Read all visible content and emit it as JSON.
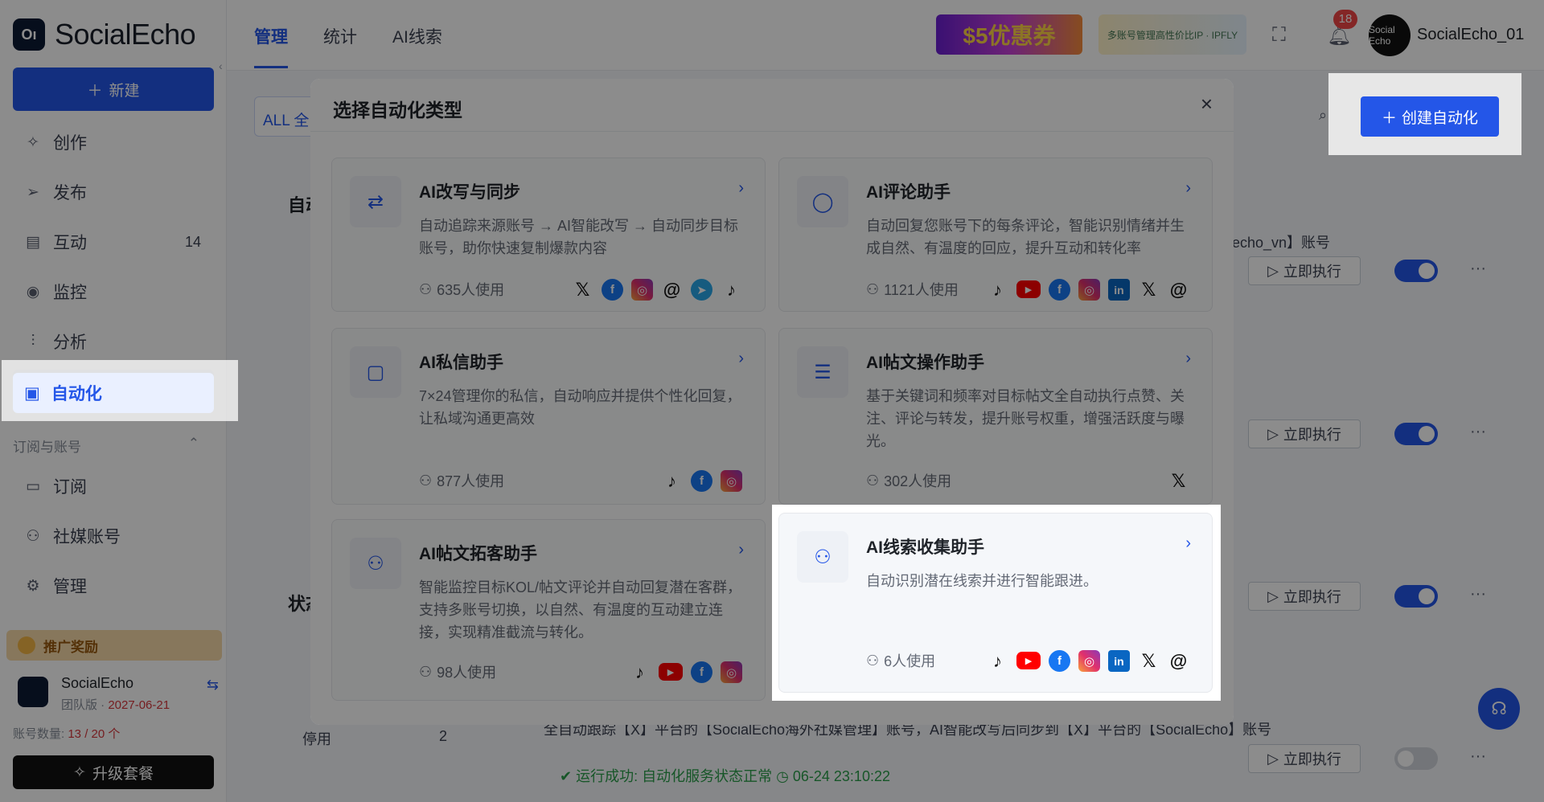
{
  "app": {
    "logo_text": "SocialEcho",
    "logo_mark": "Oı"
  },
  "sidebar": {
    "new_label": "新建",
    "items": [
      {
        "label": "创作",
        "icon": "sparkle-icon",
        "count": ""
      },
      {
        "label": "发布",
        "icon": "send-icon",
        "count": ""
      },
      {
        "label": "互动",
        "icon": "message-icon",
        "count": "14"
      },
      {
        "label": "监控",
        "icon": "location-icon",
        "count": ""
      },
      {
        "label": "分析",
        "icon": "chart-icon",
        "count": ""
      },
      {
        "label": "自动化",
        "icon": "robot-icon",
        "count": ""
      }
    ],
    "section_label": "订阅与账号",
    "items2": [
      {
        "label": "订阅",
        "icon": "card-icon"
      },
      {
        "label": "社媒账号",
        "icon": "user-icon"
      },
      {
        "label": "管理",
        "icon": "gear-icon"
      }
    ],
    "promo_label": "推广奖励",
    "team": {
      "name": "SocialEcho",
      "plan_prefix": "团队版 · ",
      "plan_date": "2027-06-21"
    },
    "account_prefix": "账号数量: ",
    "account_count": "13 / 20 个",
    "upgrade_label": "升级套餐"
  },
  "topbar": {
    "tabs": [
      "管理",
      "统计",
      "AI线索"
    ],
    "coupon": "$5优惠券",
    "ad_text": "多账号管理高性价比IP · IPFLY",
    "notifications": "18",
    "user_avatar": "Social Echo",
    "user_name": "SocialEcho_01"
  },
  "main": {
    "filter_label": "ALL 全",
    "create_label": "创建自动化",
    "section1": "自动",
    "section2": "状态",
    "stop_label": "停用",
    "stop_count": "2",
    "run_label": "立即执行",
    "bg_desc": "全自动跟踪【X】平台的【SocialEcho海外社媒管理】账号，AI智能改写后同步到【X】平台的【SocialEcho】账号",
    "bg_desc2": "echo_vn】账号",
    "bg_status": "运行成功: 自动化服务状态正常",
    "bg_time": "06-24 23:10:22"
  },
  "modal": {
    "title": "选择自动化类型",
    "cards": [
      {
        "title": "AI改写与同步",
        "icon": "repost-icon",
        "desc": "自动追踪来源账号 → AI智能改写 → 自动同步目标账号，助你快速复制爆款内容",
        "users": "635人使用",
        "platforms": [
          "x",
          "fb",
          "ig",
          "th",
          "tg",
          "tt"
        ]
      },
      {
        "title": "AI评论助手",
        "icon": "comment-icon",
        "desc": "自动回复您账号下的每条评论，智能识别情绪并生成自然、有温度的回应，提升互动和转化率",
        "users": "1121人使用",
        "platforms": [
          "tt",
          "yt",
          "fb",
          "ig",
          "li",
          "x",
          "th"
        ]
      },
      {
        "title": "AI私信助手",
        "icon": "chat-icon",
        "desc": "7×24管理你的私信，自动响应并提供个性化回复，让私域沟通更高效",
        "users": "877人使用",
        "platforms": [
          "tt",
          "fb",
          "ig"
        ]
      },
      {
        "title": "AI帖文操作助手",
        "icon": "sliders-icon",
        "desc": "基于关键词和频率对目标帖文全自动执行点赞、关注、评论与转发，提升账号权重，增强活跃度与曝光。",
        "users": "302人使用",
        "platforms": [
          "x"
        ]
      },
      {
        "title": "AI帖文拓客助手",
        "icon": "user-add-icon",
        "desc": "智能监控目标KOL/帖文评论并自动回复潜在客群，支持多账号切换，以自然、有温度的互动建立连接，实现精准截流与转化。",
        "users": "98人使用",
        "platforms": [
          "tt",
          "yt",
          "fb",
          "ig"
        ]
      },
      {
        "title": "AI线索收集助手",
        "icon": "user-add-icon",
        "desc": "自动识别潜在线索并进行智能跟进。",
        "users": "6人使用",
        "platforms": [
          "tt",
          "yt",
          "fb",
          "ig",
          "li",
          "x",
          "th"
        ]
      }
    ]
  },
  "platform_glyphs": {
    "x": "𝕏",
    "fb": "f",
    "ig": "◎",
    "th": "@",
    "tg": "➤",
    "tt": "♪",
    "yt": "▶",
    "li": "in"
  },
  "colors": {
    "accent": "#2456e8",
    "danger": "#f04646",
    "success": "#2a9d4a"
  }
}
